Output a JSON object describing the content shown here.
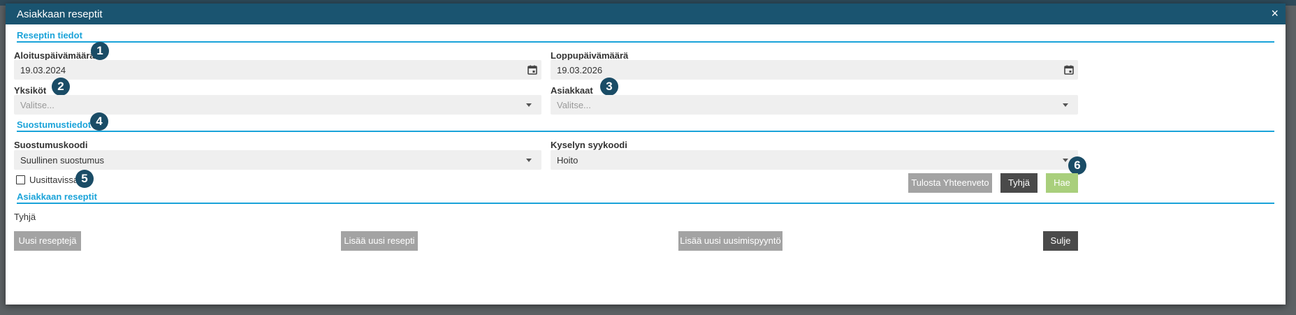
{
  "dialog": {
    "title": "Asiakkaan reseptit",
    "close_label": "×"
  },
  "sections": {
    "prescription_info": "Reseptin tiedot",
    "consent_info": "Suostumustiedot",
    "customer_prescriptions": "Asiakkaan reseptit"
  },
  "fields": {
    "start_date": {
      "label": "Aloituspäivämäärä",
      "value": "19.03.2024"
    },
    "end_date": {
      "label": "Loppupäivämäärä",
      "value": "19.03.2026"
    },
    "units": {
      "label": "Yksiköt",
      "placeholder": "Valitse..."
    },
    "customers": {
      "label": "Asiakkaat",
      "placeholder": "Valitse..."
    },
    "consent_code": {
      "label": "Suostumuskoodi",
      "value": "Suullinen suostumus"
    },
    "query_reason_code": {
      "label": "Kyselyn syykoodi",
      "value": "Hoito"
    },
    "renewable": {
      "label": "Uusittavissa",
      "checked": false
    }
  },
  "buttons": {
    "print_summary": "Tulosta Yhteenveto",
    "clear": "Tyhjä",
    "search": "Hae",
    "new_prescriptions": "Uusi reseptejä",
    "add_prescription": "Lisää uusi resepti",
    "add_renewal_request": "Lisää uusi uusimispyyntö",
    "close": "Sulje"
  },
  "results": {
    "empty_text": "Tyhjä"
  },
  "badges": [
    "1",
    "2",
    "3",
    "4",
    "5",
    "6"
  ],
  "colors": {
    "header": "#1a5470",
    "accent": "#1aa3d9",
    "badge": "#1a4c66",
    "button_gray": "#a3a3a3",
    "button_dark": "#4a4a4a",
    "button_green": "#a9cf7c"
  }
}
